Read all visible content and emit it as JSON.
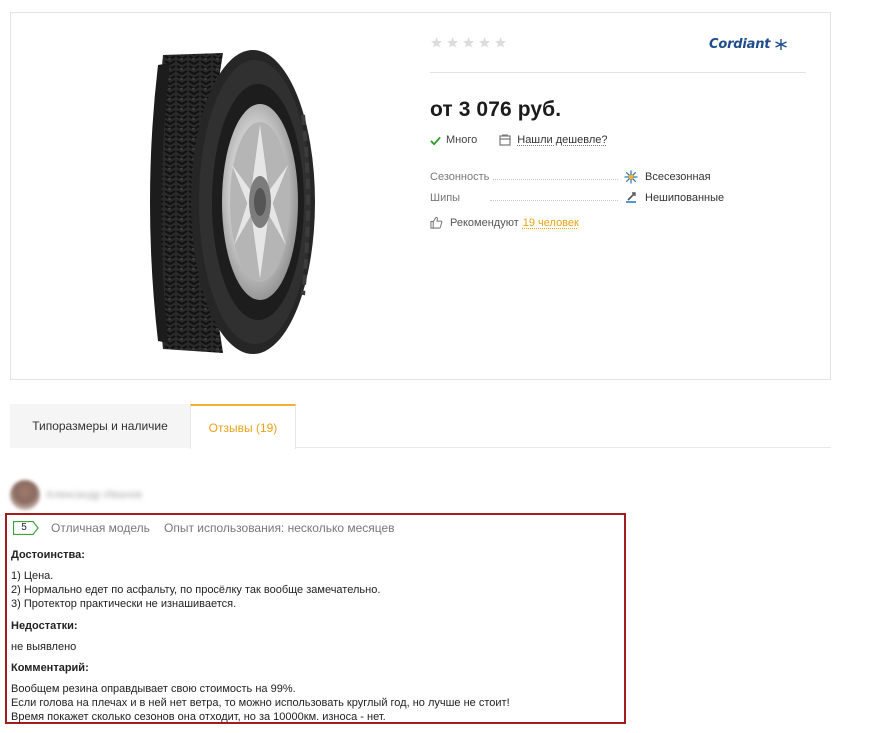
{
  "product": {
    "rating_stars": 0,
    "rating_max": 5,
    "brand": "Cordiant",
    "price": "от 3 076 руб.",
    "availability": "Много",
    "cheaper_link": "Нашли дешевле?",
    "specs": [
      {
        "label": "Сезонность",
        "value": "Всесезонная",
        "icon": "all-season-icon"
      },
      {
        "label": "Шипы",
        "value": "Нешипованные",
        "icon": "studless-icon"
      }
    ],
    "recommend": {
      "prefix": "Рекомендуют",
      "link": "19 человек"
    }
  },
  "tabs": [
    {
      "label": "Типоразмеры и наличие",
      "active": false
    },
    {
      "label": "Отзывы (19)",
      "active": true
    }
  ],
  "review": {
    "author": "Александр Иванов",
    "rating": "5",
    "title": "Отличная модель",
    "experience": "Опыт использования: несколько месяцев",
    "pros_heading": "Достоинства:",
    "pros": [
      "1) Цена.",
      "2) Нормально едет по асфальту, по просёлку так вообще замечательно.",
      "3) Протектор практически не изнашивается."
    ],
    "cons_heading": "Недостатки:",
    "cons": [
      "не выявлено"
    ],
    "comment_heading": "Комментарий:",
    "comment": [
      "Вообщем резина оправдывает свою стоимость на 99%.",
      "Если голова на плечах и в ней нет ветра, то можно использовать круглый год, но лучше не стоит!",
      "Время покажет сколько сезонов она отходит, но за 10000км. износа - нет."
    ]
  },
  "colors": {
    "accent": "#e8a317",
    "brand": "#1f4e8c",
    "highlight_border": "#a31d1d",
    "check": "#2e9e2e"
  }
}
